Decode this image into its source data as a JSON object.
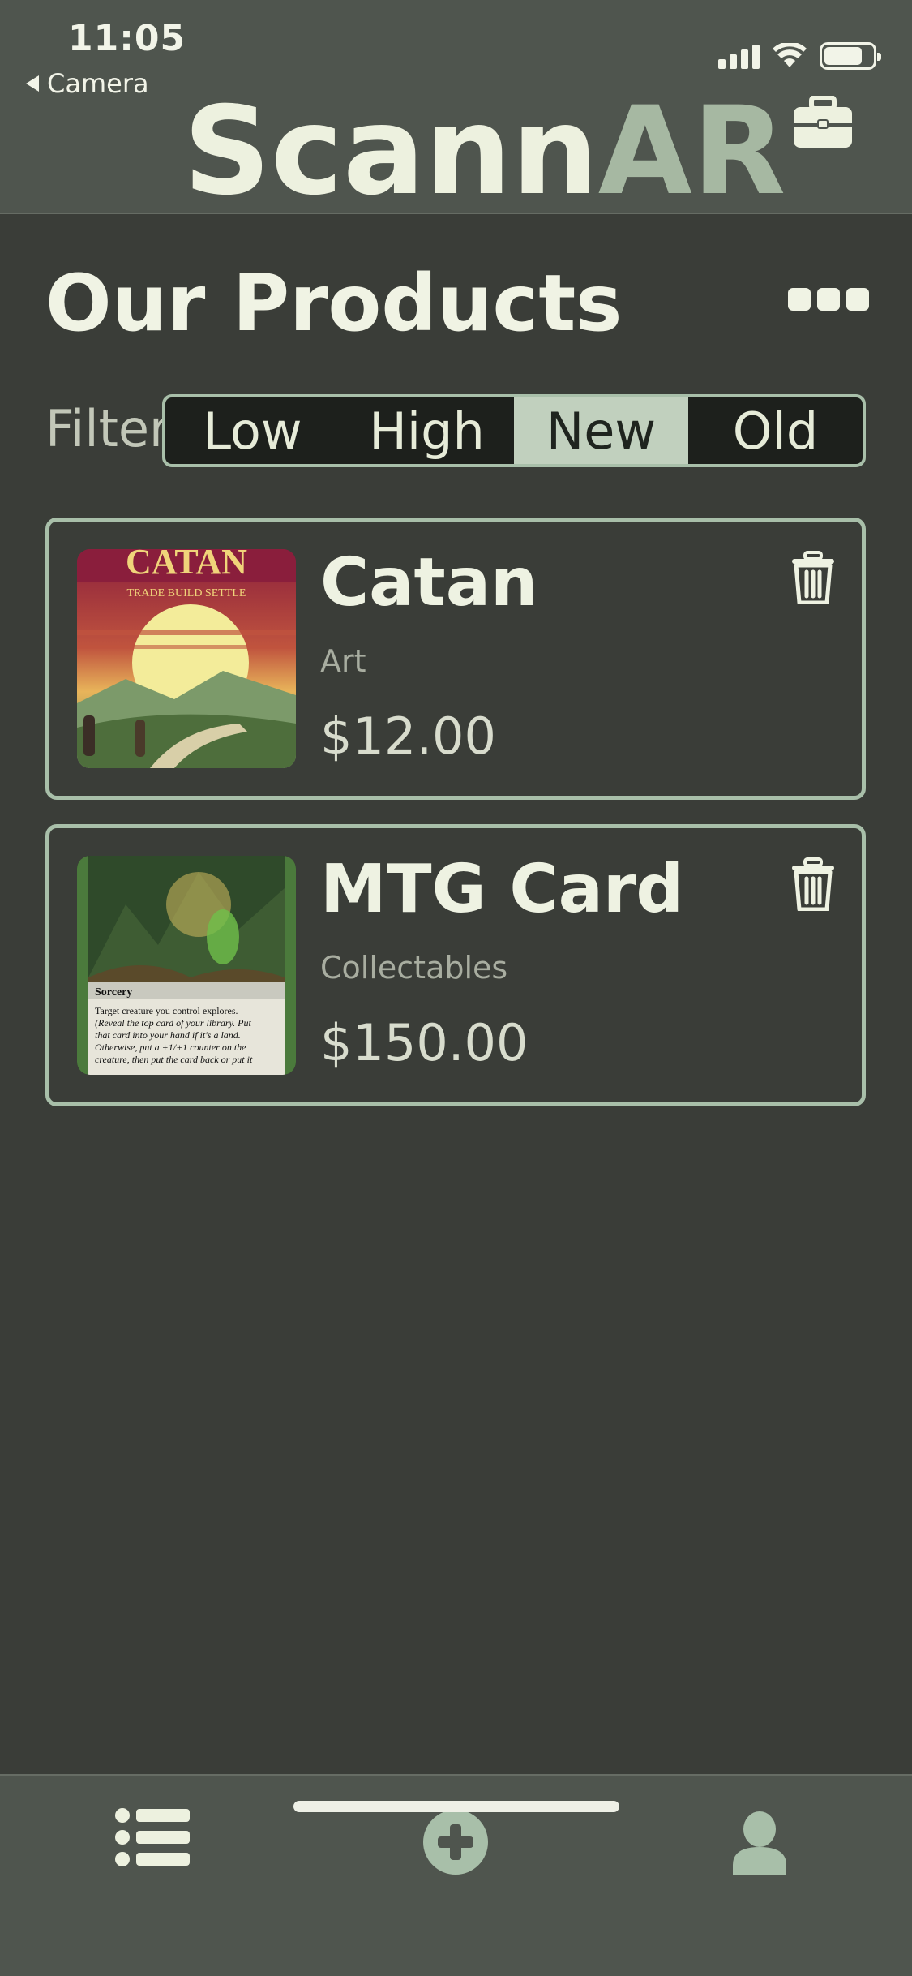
{
  "status_bar": {
    "time": "11:05",
    "back_app": "Camera"
  },
  "header": {
    "logo_part1": "Scann",
    "logo_part2": "AR"
  },
  "page": {
    "title": "Our Products",
    "filter_label": "Filter",
    "filters": [
      "Low",
      "High",
      "New",
      "Old"
    ],
    "selected_filter": "New"
  },
  "products": [
    {
      "name": "Catan",
      "category": "Art",
      "price": "$12.00",
      "image": "catan-box-art"
    },
    {
      "name": "MTG Card",
      "category": "Collectables",
      "price": "$150.00",
      "image": "mtg-card-art"
    }
  ],
  "tab_bar": {
    "items": [
      "list-icon",
      "plus-circle-icon",
      "person-icon"
    ]
  },
  "colors": {
    "background": "#3a3d38",
    "bar": "#4f554e",
    "accent": "#a8bfa9",
    "text": "#f0f3e4"
  }
}
